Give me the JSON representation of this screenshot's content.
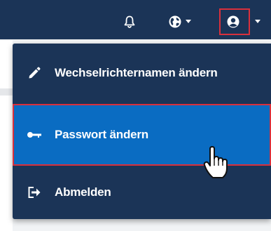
{
  "topbar": {
    "icons": [
      "bell-icon",
      "globe-icon",
      "user-circle-icon"
    ],
    "user_menu_open": true
  },
  "menu": {
    "items": [
      {
        "label": "Wechselrichternamen ändern",
        "icon": "pencil-icon"
      },
      {
        "label": "Passwort ändern",
        "icon": "key-icon",
        "state": "hovered"
      },
      {
        "label": "Abmelden",
        "icon": "sign-out-icon"
      }
    ]
  },
  "colors": {
    "navbar": "#1b3457",
    "dropdown": "#1b3457",
    "active_item": "#0a6cc2",
    "highlight_border": "#d9303c",
    "text": "#ffffff"
  }
}
